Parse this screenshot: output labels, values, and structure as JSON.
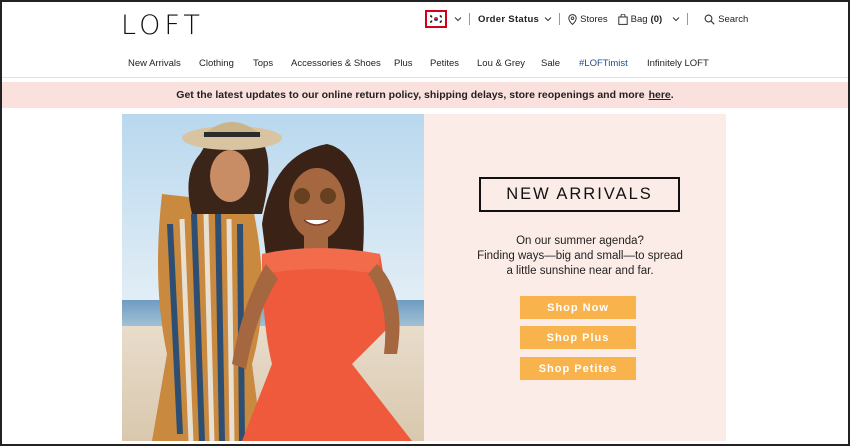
{
  "brand": {
    "logo": "LOFT"
  },
  "utility": {
    "order_status": "Order Status",
    "stores": "Stores",
    "bag_label": "Bag",
    "bag_count": "(0)",
    "search": "Search"
  },
  "nav": {
    "items": [
      {
        "label": "New Arrivals"
      },
      {
        "label": "Clothing"
      },
      {
        "label": "Tops"
      },
      {
        "label": "Accessories & Shoes"
      },
      {
        "label": "Plus"
      },
      {
        "label": "Petites"
      },
      {
        "label": "Lou & Grey"
      },
      {
        "label": "Sale"
      },
      {
        "label": "#LOFTimist"
      },
      {
        "label": "Infinitely LOFT"
      }
    ]
  },
  "promo": {
    "text": "Get the latest updates to our online return policy, shipping delays, store reopenings and more",
    "link": "here",
    "suffix": "."
  },
  "hero": {
    "heading": "NEW ARRIVALS",
    "copy_line1": "On our summer agenda?",
    "copy_line2": "Finding ways—big and small—to spread",
    "copy_line3": "a little sunshine near and far.",
    "buttons": [
      "Shop Now",
      "Shop Plus",
      "Shop Petites"
    ]
  },
  "colors": {
    "promo_bg": "#fbe1de",
    "panel_bg": "#fcece7",
    "button": "#f8b34c",
    "flag_highlight": "#d0021b",
    "nav_highlight": "#1e4d8c"
  }
}
